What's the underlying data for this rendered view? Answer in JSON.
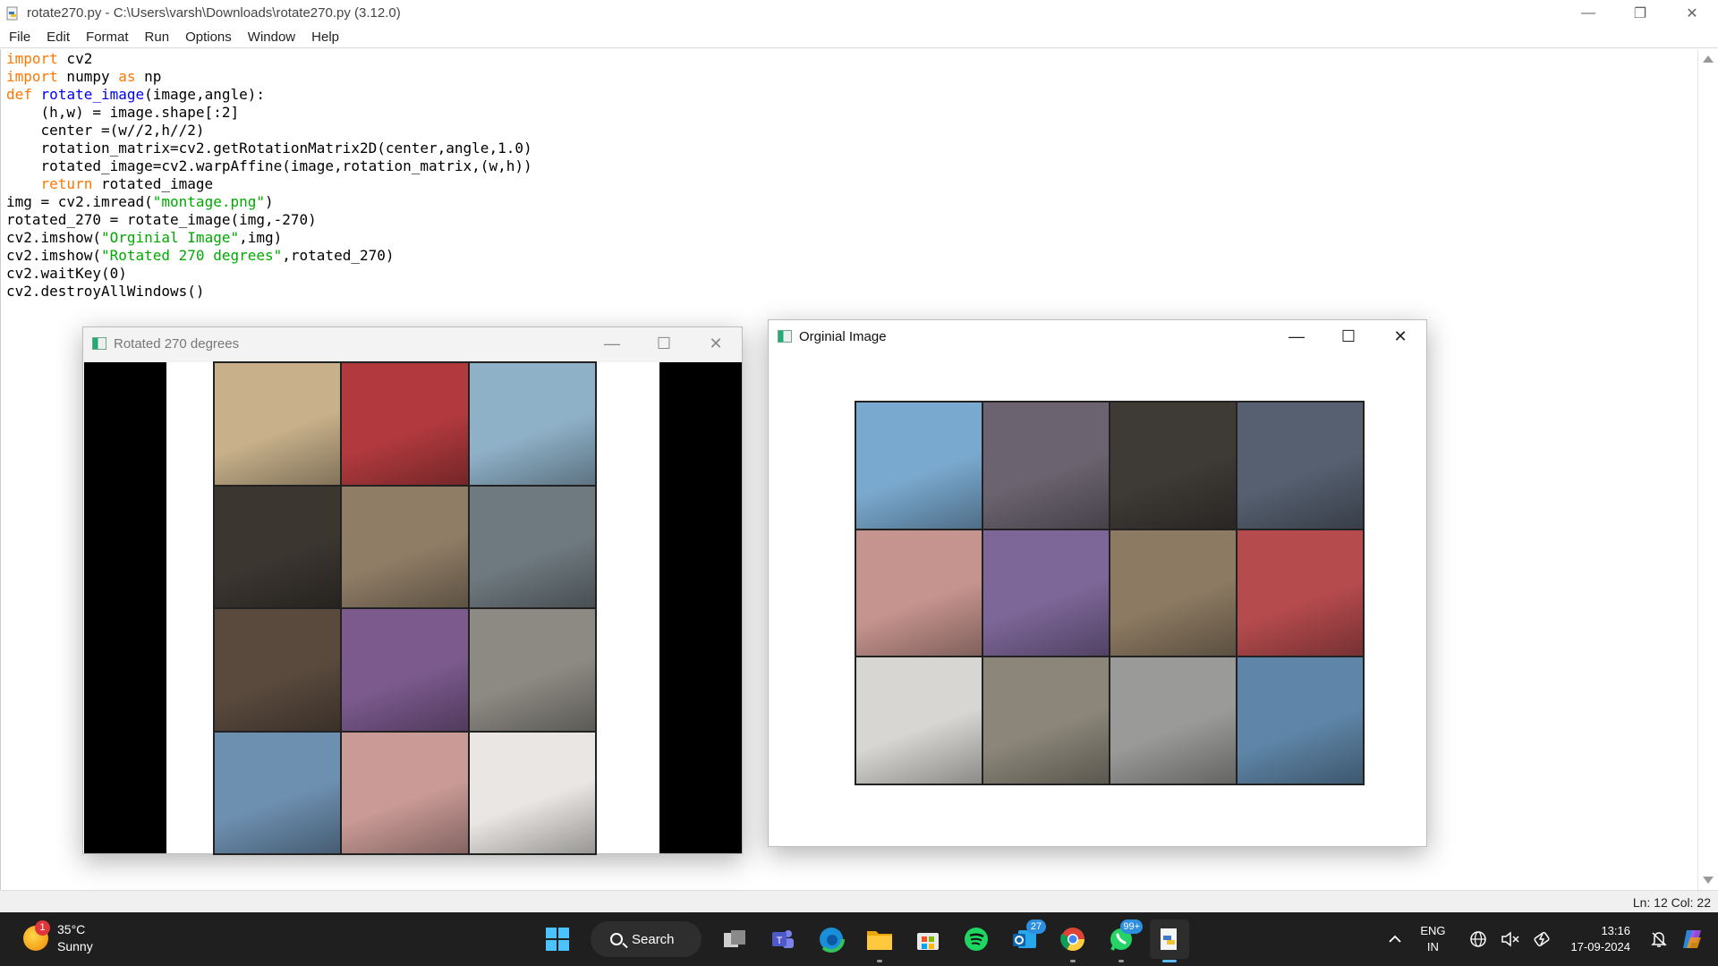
{
  "idle": {
    "title": "rotate270.py - C:\\Users\\varsh\\Downloads\\rotate270.py (3.12.0)",
    "menu": [
      "File",
      "Edit",
      "Format",
      "Run",
      "Options",
      "Window",
      "Help"
    ],
    "status": "Ln: 12   Col: 22"
  },
  "code": {
    "lines": [
      [
        {
          "t": "import",
          "c": "kw"
        },
        {
          "t": " cv2"
        }
      ],
      [
        {
          "t": "import",
          "c": "kw"
        },
        {
          "t": " numpy "
        },
        {
          "t": "as",
          "c": "kw"
        },
        {
          "t": " np"
        }
      ],
      [
        {
          "t": "def",
          "c": "kw"
        },
        {
          "t": " "
        },
        {
          "t": "rotate_image",
          "c": "fn"
        },
        {
          "t": "(image,angle):"
        }
      ],
      [
        {
          "t": "    (h,w) = image.shape[:2]"
        }
      ],
      [
        {
          "t": "    center =(w//2,h//2)"
        }
      ],
      [
        {
          "t": "    rotation_matrix=cv2.getRotationMatrix2D(center,angle,1.0)"
        }
      ],
      [
        {
          "t": "    rotated_image=cv2.warpAffine(image,rotation_matrix,(w,h))"
        }
      ],
      [
        {
          "t": "    "
        },
        {
          "t": "return",
          "c": "kw"
        },
        {
          "t": " rotated_image"
        }
      ],
      [
        {
          "t": "img = cv2.imread("
        },
        {
          "t": "\"montage.png\"",
          "c": "str"
        },
        {
          "t": ")"
        }
      ],
      [
        {
          "t": "rotated_270 = rotate_image(img,-270)"
        }
      ],
      [
        {
          "t": "cv2.imshow("
        },
        {
          "t": "\"Orginial Image\"",
          "c": "str"
        },
        {
          "t": ",img)"
        }
      ],
      [
        {
          "t": "cv2.imshow("
        },
        {
          "t": "\"Rotated 270 degrees\"",
          "c": "str"
        },
        {
          "t": ",rotated_270)"
        }
      ],
      [
        {
          "t": "cv2.waitKey(0)"
        }
      ],
      [
        {
          "t": "cv2.destroyAllWindows()"
        }
      ]
    ]
  },
  "rotated_window": {
    "title": "Rotated 270 degrees",
    "tiles": [
      "#c7b08a",
      "#b23a3e",
      "#8fb1c8",
      "#3b3630",
      "#8f7d66",
      "#6f7a80",
      "#5a4a3e",
      "#7c5a8e",
      "#8c8a82",
      "#6d8fb0",
      "#c99a96",
      "#e9e6e3"
    ]
  },
  "original_window": {
    "title": "Orginial Image",
    "tiles": [
      "#7aa9cf",
      "#6b6470",
      "#3e3a36",
      "#566070",
      "#c6948e",
      "#7d6698",
      "#8c7a62",
      "#b64b4e",
      "#d8d6d2",
      "#8b8679",
      "#9a9a98",
      "#5f86a8"
    ]
  },
  "taskbar": {
    "weather_temp": "35°C",
    "weather_desc": "Sunny",
    "weather_badge": "1",
    "search_label": "Search",
    "outlook_badge": "27",
    "whatsapp_badge": "99+",
    "lang_top": "ENG",
    "lang_bottom": "IN",
    "time": "13:16",
    "date": "17-09-2024"
  }
}
